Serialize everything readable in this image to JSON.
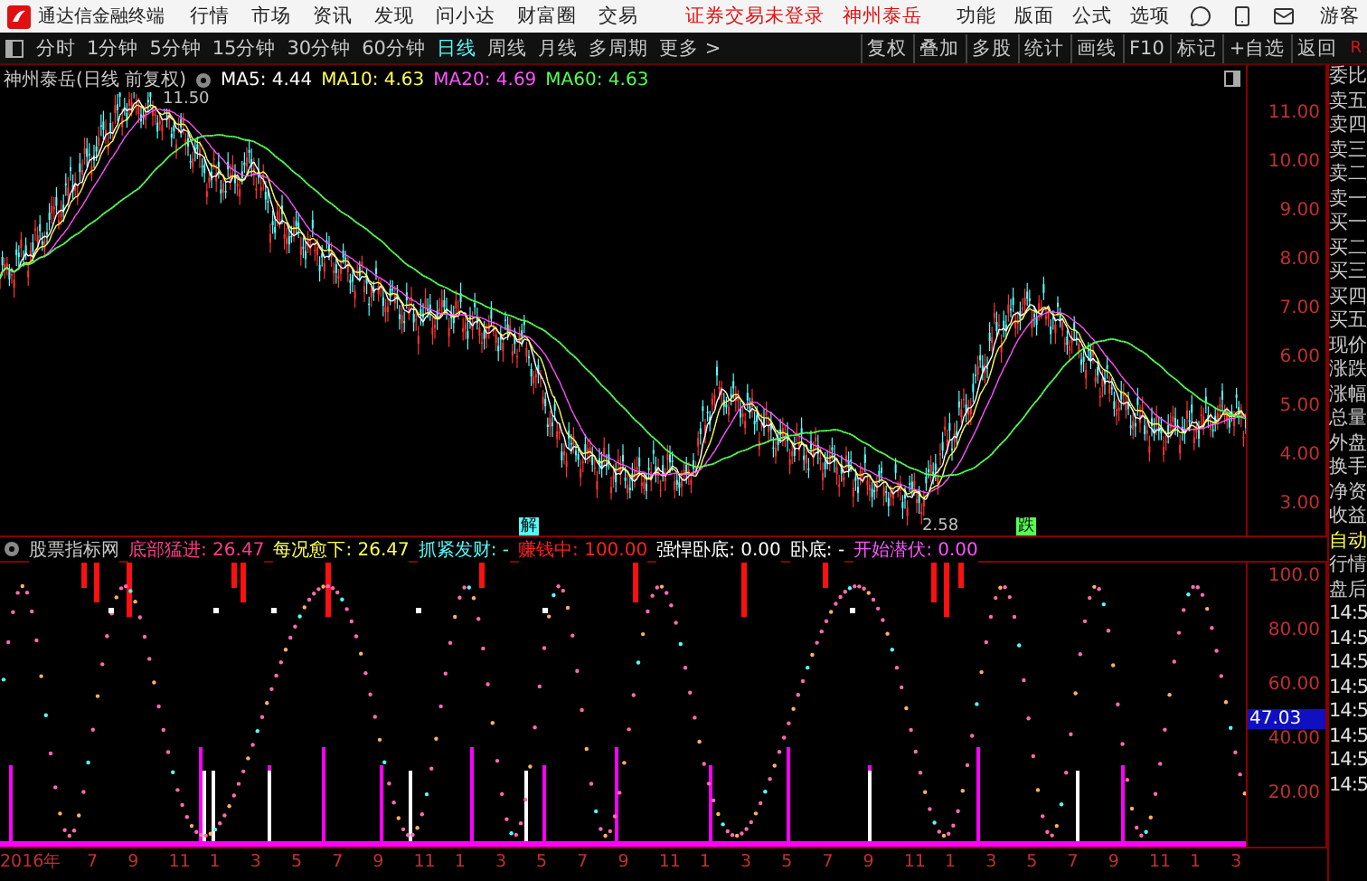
{
  "menu_bar": {
    "app_title": "通达信金融终端",
    "menus": [
      "行情",
      "市场",
      "资讯",
      "发现",
      "问小达",
      "财富圈",
      "交易"
    ],
    "login_status": "证券交易未登录",
    "stock_name": "神州泰岳",
    "actions": [
      "功能",
      "版面",
      "公式",
      "选项"
    ],
    "user": "游客"
  },
  "toolbar": {
    "periods": [
      {
        "label": "分时",
        "selected": false
      },
      {
        "label": "1分钟",
        "selected": false
      },
      {
        "label": "5分钟",
        "selected": false
      },
      {
        "label": "15分钟",
        "selected": false
      },
      {
        "label": "30分钟",
        "selected": false
      },
      {
        "label": "60分钟",
        "selected": false
      },
      {
        "label": "日线",
        "selected": true
      },
      {
        "label": "周线",
        "selected": false
      },
      {
        "label": "月线",
        "selected": false
      },
      {
        "label": "多周期",
        "selected": false
      }
    ],
    "more": "更多 >",
    "tools": [
      "复权",
      "叠加",
      "多股",
      "统计",
      "画线",
      "F10",
      "标记",
      "+自选",
      "返回"
    ],
    "corner": "R"
  },
  "price_chart": {
    "title": "神州泰岳(日线 前复权)",
    "ma": [
      {
        "label": "MA5: 4.44",
        "color": "#ffffff"
      },
      {
        "label": "MA10: 4.63",
        "color": "#ffff54"
      },
      {
        "label": "MA20: 4.69",
        "color": "#ff54ff"
      },
      {
        "label": "MA60: 4.63",
        "color": "#54ff54"
      }
    ],
    "high_label": "11.50",
    "low_label": "2.58",
    "markers": [
      "解",
      "跌"
    ],
    "axis": [
      "11.00",
      "10.00",
      "9.00",
      "8.00",
      "7.00",
      "6.00",
      "5.00",
      "4.00",
      "3.00"
    ]
  },
  "indicator": {
    "name": "股票指标网",
    "items": [
      {
        "label": "底部猛进: 26.47",
        "color": "#ff3c8c"
      },
      {
        "label": "每况愈下: 26.47",
        "color": "#ffff54"
      },
      {
        "label": "抓紧发财: -",
        "color": "#54fcfc"
      },
      {
        "label": "赚钱中: 100.00",
        "color": "#ff2020"
      },
      {
        "label": "强悍卧底: 0.00",
        "color": "#ffffff"
      },
      {
        "label": "卧底: -",
        "color": "#ffffff"
      },
      {
        "label": "开始潜伏: 0.00",
        "color": "#ff54ff"
      }
    ],
    "axis": [
      {
        "label": "100.0",
        "highlighted": false
      },
      {
        "label": "80.00",
        "highlighted": false
      },
      {
        "label": "60.00",
        "highlighted": false
      },
      {
        "label": "47.03",
        "highlighted": true
      },
      {
        "label": "40.00",
        "highlighted": false
      },
      {
        "label": "20.00",
        "highlighted": false
      }
    ]
  },
  "time_axis": [
    "2016年",
    "7",
    "9",
    "11",
    "1",
    "3",
    "5",
    "7",
    "9",
    "11",
    "1",
    "3",
    "5",
    "7",
    "9",
    "11",
    "1",
    "3",
    "5",
    "7",
    "9",
    "11",
    "1",
    "3",
    "5",
    "7",
    "9",
    "11",
    "1",
    "3"
  ],
  "side_panel": {
    "quote_labels": [
      "委比",
      "卖五",
      "卖四",
      "卖三",
      "卖二",
      "卖一",
      "买一",
      "买二",
      "买三",
      "买四",
      "买五",
      "现价",
      "涨跌",
      "涨幅",
      "总量",
      "外盘",
      "换手",
      "净资",
      "收益"
    ],
    "mode": "自动",
    "tabs": [
      "行情",
      "盘后"
    ],
    "times": [
      "14:5",
      "14:5",
      "14:5",
      "14:5",
      "14:5",
      "14:5",
      "14:5",
      "14:5"
    ]
  }
}
